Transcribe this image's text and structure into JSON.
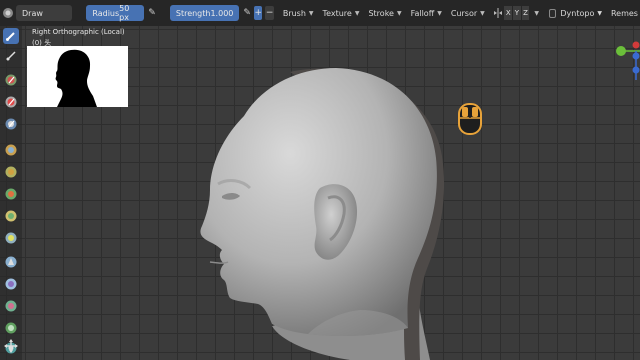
{
  "header": {
    "mode": "Draw",
    "radius_label": "Radius",
    "radius_value": "50 px",
    "strength_label": "Strength",
    "strength_value": "1.000",
    "plus": "+",
    "minus": "−",
    "menus": [
      "Brush",
      "Texture",
      "Stroke",
      "Falloff",
      "Cursor"
    ],
    "axes": [
      "X",
      "Y",
      "Z"
    ],
    "dyntopo_label": "Dyntopo",
    "remesh_label": "Remes"
  },
  "viewport": {
    "view_name": "Right Orthographic (Local)",
    "object_name": "(0) 头"
  },
  "toolbar": {
    "tools": [
      "draw-brush",
      "draw-sharp-brush",
      "clay-brush",
      "clay-strips-brush",
      "layer-brush",
      "inflate-brush",
      "blob-brush",
      "crease-brush",
      "smooth-brush",
      "flatten-brush",
      "fill-brush",
      "scrape-brush",
      "multires-displacement-brush",
      "pinch-brush",
      "grab-brush",
      "snake-hook-brush",
      "move-tool"
    ]
  },
  "colors": {
    "accent": "#4772b3",
    "mouse_hint": "#e8a33a",
    "gizmo_x": "#d13a3a",
    "gizmo_y": "#6bbf3a",
    "gizmo_z": "#3a6bd1"
  }
}
